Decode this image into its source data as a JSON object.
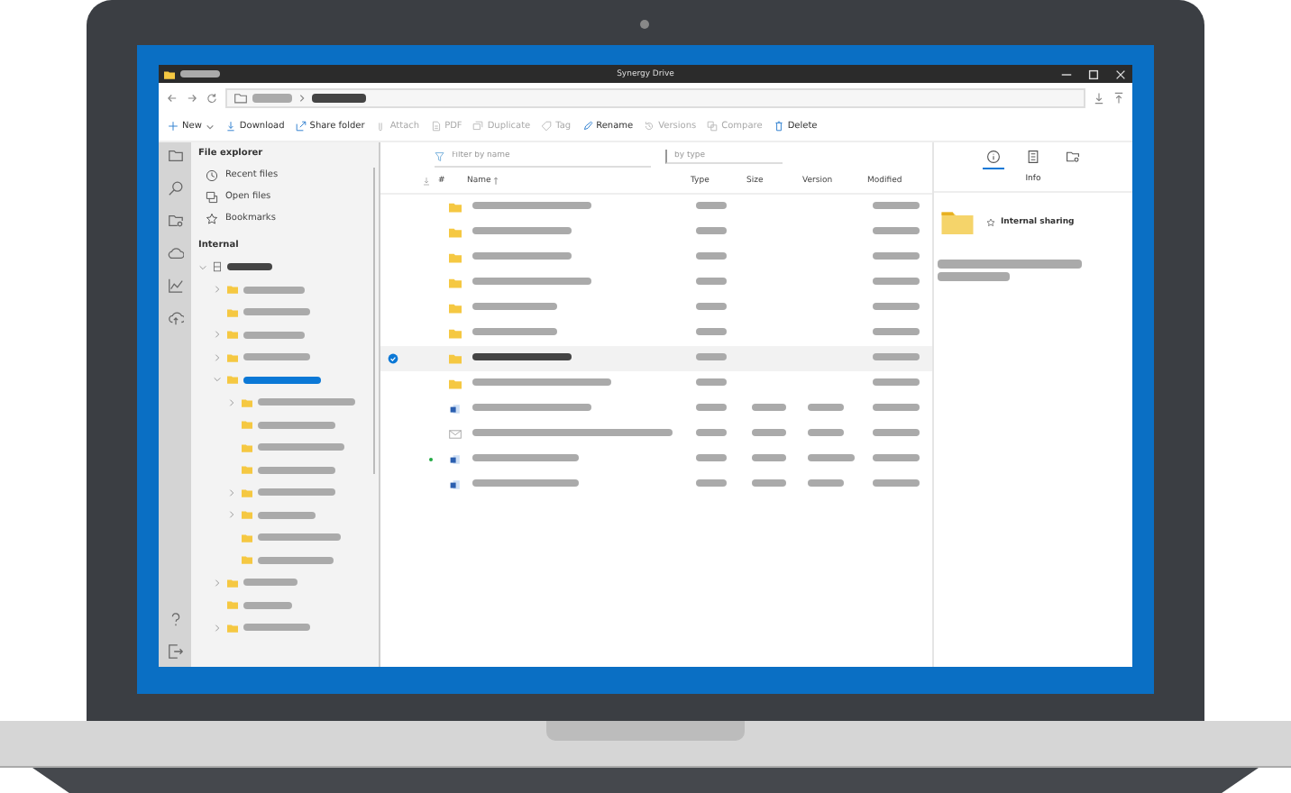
{
  "window": {
    "title": "Synergy Drive"
  },
  "toolbar": [
    {
      "label": "New",
      "disabled": false,
      "dropdown": true
    },
    {
      "label": "Download",
      "disabled": false,
      "dropdown": false
    },
    {
      "label": "Share folder",
      "disabled": false,
      "dropdown": false
    },
    {
      "label": "Attach",
      "disabled": true,
      "dropdown": false
    },
    {
      "label": "PDF",
      "disabled": true,
      "dropdown": false
    },
    {
      "label": "Duplicate",
      "disabled": true,
      "dropdown": false
    },
    {
      "label": "Tag",
      "disabled": true,
      "dropdown": false
    },
    {
      "label": "Rename",
      "disabled": false,
      "dropdown": false
    },
    {
      "label": "Versions",
      "disabled": true,
      "dropdown": false
    },
    {
      "label": "Compare",
      "disabled": true,
      "dropdown": false
    },
    {
      "label": "Delete",
      "disabled": false,
      "dropdown": false
    }
  ],
  "explorer": {
    "title": "File explorer",
    "nav": [
      {
        "label": "Recent files"
      },
      {
        "label": "Open files"
      },
      {
        "label": "Bookmarks"
      }
    ],
    "section": "Internal",
    "tree": {
      "expanded": true,
      "children": [
        {
          "expandable": true,
          "expanded": false,
          "selected": false
        },
        {
          "expandable": false,
          "selected": false
        },
        {
          "expandable": true,
          "expanded": false,
          "selected": false
        },
        {
          "expandable": true,
          "expanded": false,
          "selected": false
        },
        {
          "expandable": true,
          "expanded": true,
          "selected": true,
          "children": [
            {
              "expandable": true,
              "expanded": false,
              "selected": false
            },
            {
              "expandable": false,
              "selected": false
            },
            {
              "expandable": false,
              "selected": false
            },
            {
              "expandable": false,
              "selected": false
            },
            {
              "expandable": true,
              "expanded": false,
              "selected": false
            },
            {
              "expandable": true,
              "expanded": false,
              "selected": false
            },
            {
              "expandable": false,
              "selected": false
            },
            {
              "expandable": false,
              "selected": false
            }
          ]
        },
        {
          "expandable": true,
          "expanded": false,
          "selected": false
        },
        {
          "expandable": false,
          "selected": false
        },
        {
          "expandable": true,
          "expanded": false,
          "selected": false
        }
      ]
    }
  },
  "filters": {
    "name": {
      "placeholder": "Filter by name"
    },
    "type": {
      "placeholder": "by type"
    }
  },
  "table": {
    "columns": [
      {
        "label": "#",
        "sorted": false
      },
      {
        "label": "Name",
        "sorted": true
      },
      {
        "label": "Type",
        "sorted": false
      },
      {
        "label": "Size",
        "sorted": false
      },
      {
        "label": "Version",
        "sorted": false
      },
      {
        "label": "Modified",
        "sorted": false
      }
    ],
    "rows": [
      {
        "kind": "folder",
        "selected": false,
        "synced": false
      },
      {
        "kind": "folder",
        "selected": false,
        "synced": false
      },
      {
        "kind": "folder",
        "selected": false,
        "synced": false
      },
      {
        "kind": "folder",
        "selected": false,
        "synced": false
      },
      {
        "kind": "folder",
        "selected": false,
        "synced": false
      },
      {
        "kind": "folder",
        "selected": false,
        "synced": false
      },
      {
        "kind": "folder",
        "selected": true,
        "synced": false
      },
      {
        "kind": "folder",
        "selected": false,
        "synced": false
      },
      {
        "kind": "word",
        "selected": false,
        "synced": false
      },
      {
        "kind": "mail",
        "selected": false,
        "synced": false
      },
      {
        "kind": "word",
        "selected": false,
        "synced": true
      },
      {
        "kind": "word",
        "selected": false,
        "synced": false
      }
    ]
  },
  "info": {
    "tabs": [
      {
        "selected": true
      },
      {
        "selected": false
      },
      {
        "selected": false
      }
    ],
    "heading": "Info",
    "sharing": "Internal sharing"
  }
}
